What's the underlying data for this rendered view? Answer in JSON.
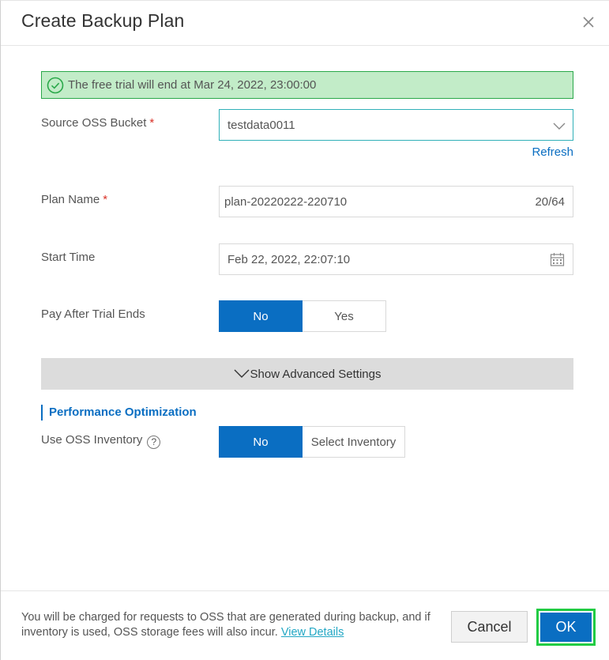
{
  "dialog": {
    "title": "Create Backup Plan",
    "close_icon": "close-icon"
  },
  "banner": {
    "text": "The free trial will end at Mar 24, 2022, 23:00:00",
    "icon": "check-circle-icon",
    "color": "#c2ecc8"
  },
  "source_bucket": {
    "label": "Source OSS Bucket",
    "required_mark": "*",
    "value": "testdata0011",
    "refresh": "Refresh"
  },
  "plan_name": {
    "label": "Plan Name",
    "required_mark": "*",
    "value": "plan-20220222-220710",
    "counter": "20/64"
  },
  "start_time": {
    "label": "Start Time",
    "value": "Feb 22, 2022, 22:07:10"
  },
  "pay_after_trial": {
    "label": "Pay After Trial Ends",
    "options": [
      "No",
      "Yes"
    ],
    "selected": "No"
  },
  "advanced": {
    "label": "Show Advanced Settings"
  },
  "performance": {
    "section_title": "Performance Optimization",
    "inventory_label": "Use OSS Inventory",
    "help_glyph": "?",
    "options": [
      "No",
      "Select Inventory"
    ],
    "selected": "No"
  },
  "footer": {
    "note": "You will be charged for requests to OSS that are generated during backup, and if inventory is used, OSS storage fees will also incur.",
    "link": "View Details",
    "cancel": "Cancel",
    "ok": "OK"
  },
  "colors": {
    "primary": "#0a6ec2",
    "banner_border": "#2aa84a",
    "ok_highlight": "#22cc44",
    "required": "#d93026"
  }
}
